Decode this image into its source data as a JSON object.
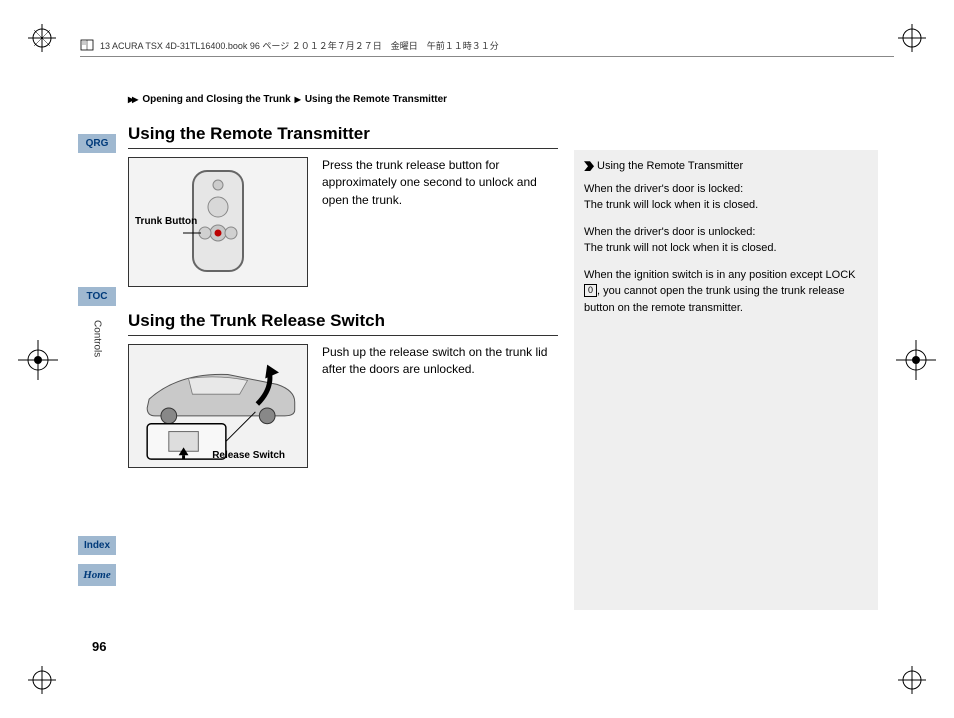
{
  "header": {
    "file_info": "13 ACURA TSX 4D-31TL16400.book  96 ページ  ２０１２年７月２７日　金曜日　午前１１時３１分"
  },
  "breadcrumb": {
    "segment1": "Opening and Closing the Trunk",
    "segment2": "Using the Remote Transmitter"
  },
  "sidebar": {
    "qrg": "QRG",
    "toc": "TOC",
    "controls": "Controls",
    "index": "Index",
    "home": "Home"
  },
  "section1": {
    "title": "Using the Remote Transmitter",
    "body": "Press the trunk release button for approximately one second to unlock and open the trunk.",
    "figure_label": "Trunk Button"
  },
  "section2": {
    "title": "Using the Trunk Release Switch",
    "body": "Push up the release switch on the trunk lid after the doors are unlocked.",
    "figure_label": "Release Switch"
  },
  "side_panel": {
    "title": "Using the Remote Transmitter",
    "p1a": "When the driver's door is locked:",
    "p1b": "The trunk will lock when it is closed.",
    "p2a": "When the driver's door is unlocked:",
    "p2b": "The trunk will not lock when it is closed.",
    "p3a": "When the ignition switch is in any position except LOCK ",
    "p3b": "0",
    "p3c": ", you cannot open the trunk using the trunk release button on the remote transmitter."
  },
  "page_number": "96"
}
